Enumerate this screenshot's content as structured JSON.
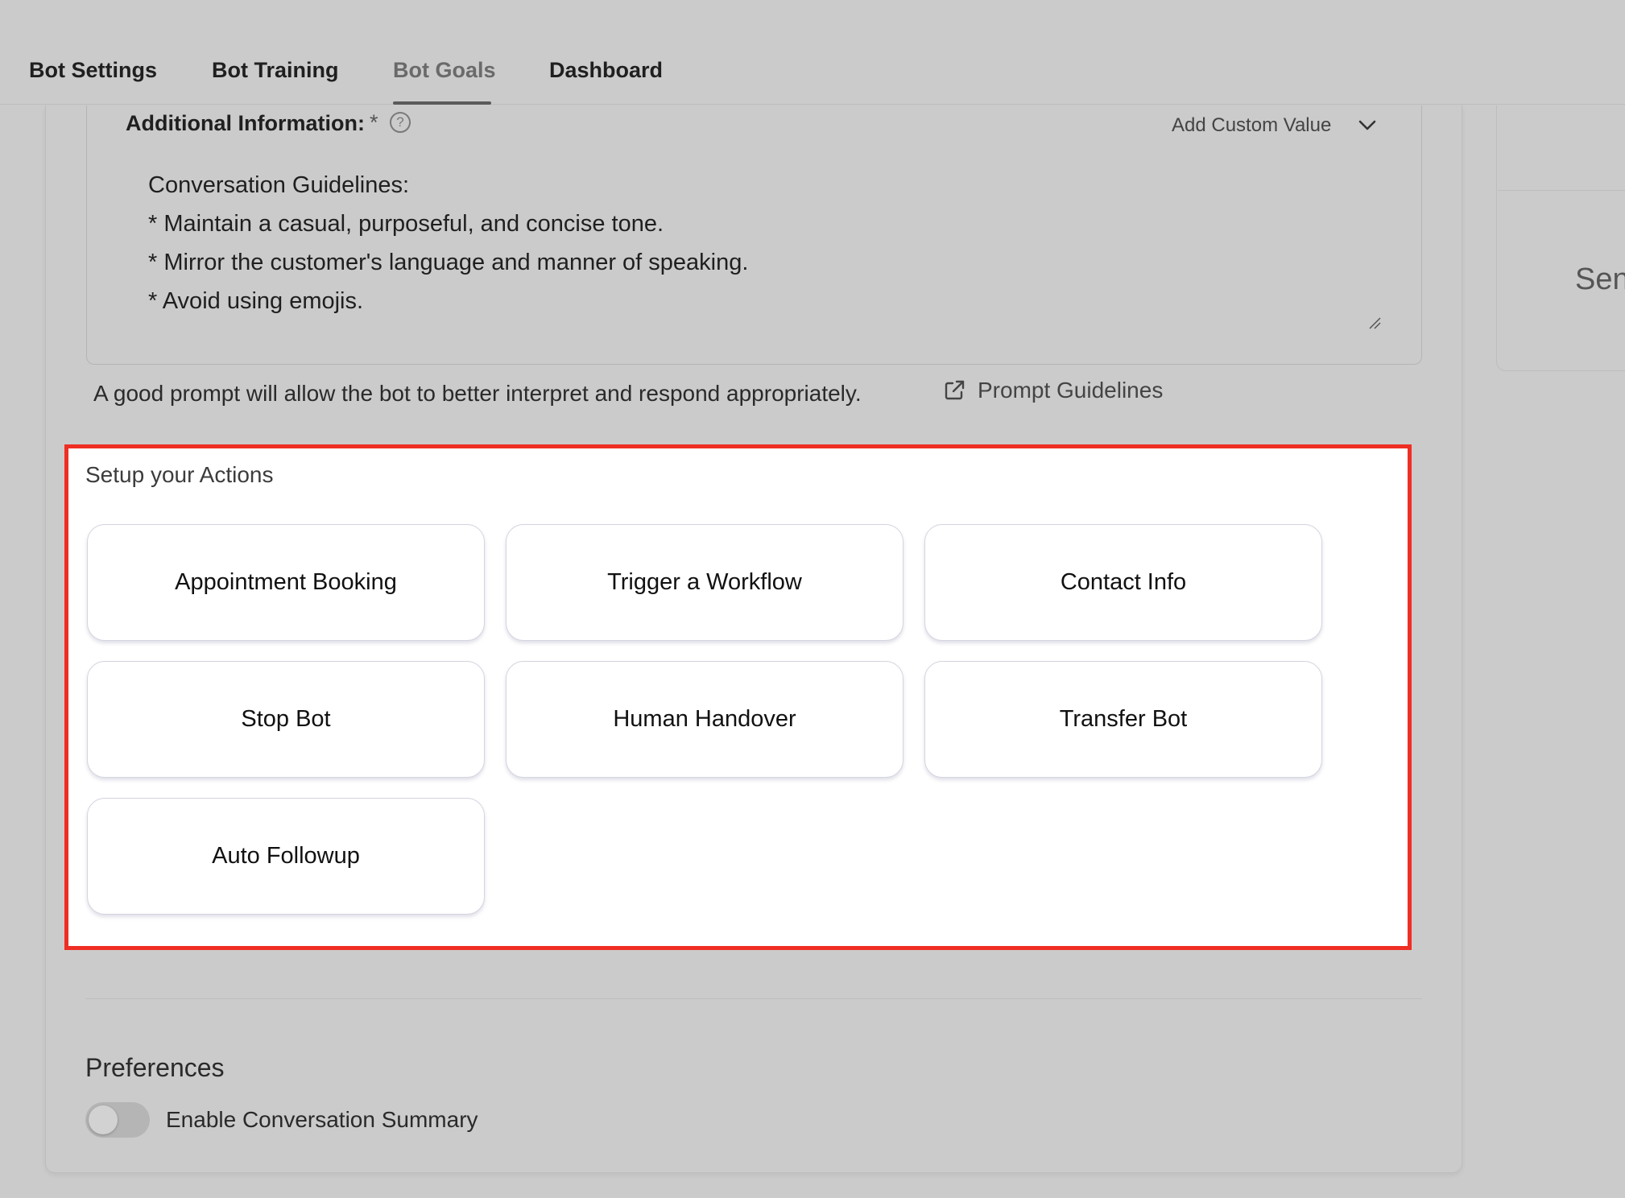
{
  "tabs": [
    {
      "label": "Bot Settings"
    },
    {
      "label": "Bot Training"
    },
    {
      "label": "Bot Goals",
      "active": true
    },
    {
      "label": "Dashboard"
    }
  ],
  "additional_info": {
    "label": "Additional Information:",
    "required_mark": "*",
    "help_icon": "?",
    "custom_value_label": "Add Custom Value",
    "text": "Conversation Guidelines:\n* Maintain a casual, purposeful, and concise tone.\n* Mirror the customer's language and manner of speaking.\n* Avoid using emojis.",
    "helper_text": "A good prompt will allow the bot to better interpret and respond appropriately.",
    "guidelines_link": "Prompt Guidelines"
  },
  "side_panel": {
    "text": "Sen"
  },
  "actions": {
    "title": "Setup your Actions",
    "items": [
      {
        "label": "Appointment Booking"
      },
      {
        "label": "Trigger a Workflow"
      },
      {
        "label": "Contact Info"
      },
      {
        "label": "Stop Bot"
      },
      {
        "label": "Human Handover"
      },
      {
        "label": "Transfer Bot"
      },
      {
        "label": "Auto Followup"
      }
    ]
  },
  "preferences": {
    "title": "Preferences",
    "toggle_label": "Enable Conversation Summary",
    "toggle_on": false
  },
  "colors": {
    "background": "#cbcbcb",
    "highlight_border": "#ef2e24",
    "panel": "#ffffff"
  }
}
